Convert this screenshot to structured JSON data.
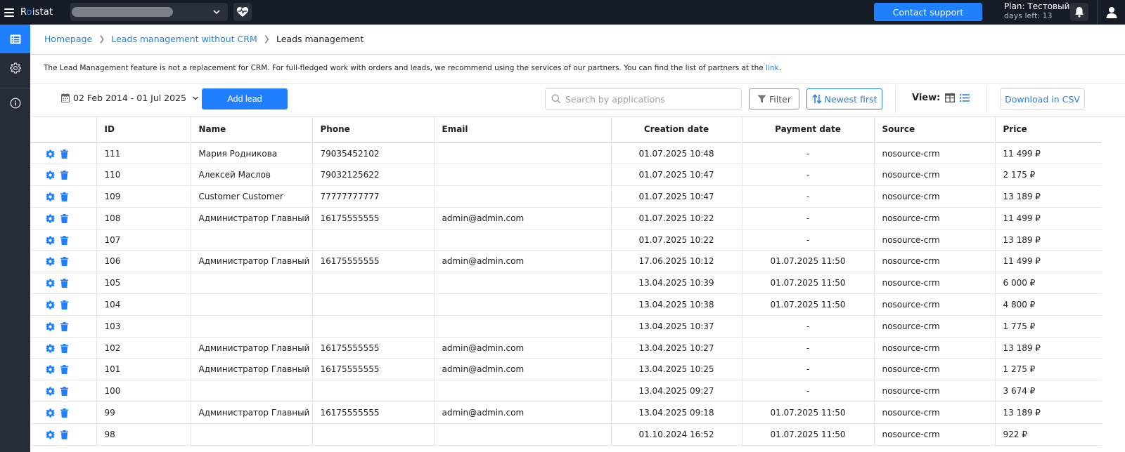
{
  "app": {
    "logo_pre": "R",
    "logo_dot": "o",
    "logo_post": "istat",
    "support_label": "Contact support",
    "plan_name": "Plan: Тестовый",
    "plan_days": "days left: 13"
  },
  "breadcrumb": {
    "items": [
      "Homepage",
      "Leads management without CRM"
    ],
    "current": "Leads management"
  },
  "notice": {
    "text": "The Lead Management feature is not a replacement for CRM. For full-fledged work with orders and leads, we recommend using the services of our partners. You can find the list of partners at the ",
    "link": "link",
    "end": "."
  },
  "toolbar": {
    "date_range": "02 Feb 2014 - 01 Jul 2025",
    "add_lead": "Add lead",
    "search_placeholder": "Search by applications",
    "filter": "Filter",
    "sort": "Newest first",
    "view_label": "View:",
    "download": "Download in CSV"
  },
  "colors": {
    "accent": "#1f7fff",
    "topbar": "#161c27",
    "sidebar": "#262d38"
  },
  "icons": {
    "settings": "gear-icon",
    "delete": "trash-icon",
    "calendar": "calendar-icon",
    "search": "search-icon",
    "filter": "funnel-icon",
    "sort": "sort-arrows-icon"
  },
  "table": {
    "columns": [
      "",
      "ID",
      "Name",
      "Phone",
      "Email",
      "Creation date",
      "Payment date",
      "Source",
      "Price"
    ],
    "rows": [
      [
        "111",
        "Мария Родникова",
        "79035452102",
        "",
        "01.07.2025 10:48",
        "-",
        "nosource-crm",
        "11 499 ₽"
      ],
      [
        "110",
        "Алексей Маслов",
        "79032125622",
        "",
        "01.07.2025 10:47",
        "-",
        "nosource-crm",
        "2 175 ₽"
      ],
      [
        "109",
        "Customer Customer",
        "77777777777",
        "",
        "01.07.2025 10:47",
        "-",
        "nosource-crm",
        "13 189 ₽"
      ],
      [
        "108",
        "Администратор Главный",
        "16175555555",
        "admin@admin.com",
        "01.07.2025 10:22",
        "-",
        "nosource-crm",
        "11 499 ₽"
      ],
      [
        "107",
        "",
        "",
        "",
        "01.07.2025 10:22",
        "-",
        "nosource-crm",
        "13 189 ₽"
      ],
      [
        "106",
        "Администратор Главный",
        "16175555555",
        "admin@admin.com",
        "17.06.2025 10:12",
        "01.07.2025 11:50",
        "nosource-crm",
        "11 499 ₽"
      ],
      [
        "105",
        "",
        "",
        "",
        "13.04.2025 10:39",
        "01.07.2025 11:50",
        "nosource-crm",
        "6 000 ₽"
      ],
      [
        "104",
        "",
        "",
        "",
        "13.04.2025 10:38",
        "01.07.2025 11:50",
        "nosource-crm",
        "4 800 ₽"
      ],
      [
        "103",
        "",
        "",
        "",
        "13.04.2025 10:37",
        "-",
        "nosource-crm",
        "1 775 ₽"
      ],
      [
        "102",
        "Администратор Главный",
        "16175555555",
        "admin@admin.com",
        "13.04.2025 10:27",
        "-",
        "nosource-crm",
        "13 189 ₽"
      ],
      [
        "101",
        "Администратор Главный",
        "16175555555",
        "admin@admin.com",
        "13.04.2025 10:25",
        "-",
        "nosource-crm",
        "1 275 ₽"
      ],
      [
        "100",
        "",
        "",
        "",
        "13.04.2025 09:27",
        "-",
        "nosource-crm",
        "3 674 ₽"
      ],
      [
        "99",
        "Администратор Главный",
        "16175555555",
        "admin@admin.com",
        "13.04.2025 09:18",
        "01.07.2025 11:50",
        "nosource-crm",
        "13 189 ₽"
      ],
      [
        "98",
        "",
        "",
        "",
        "01.10.2024 16:52",
        "01.07.2025 11:50",
        "nosource-crm",
        "922 ₽"
      ]
    ]
  }
}
